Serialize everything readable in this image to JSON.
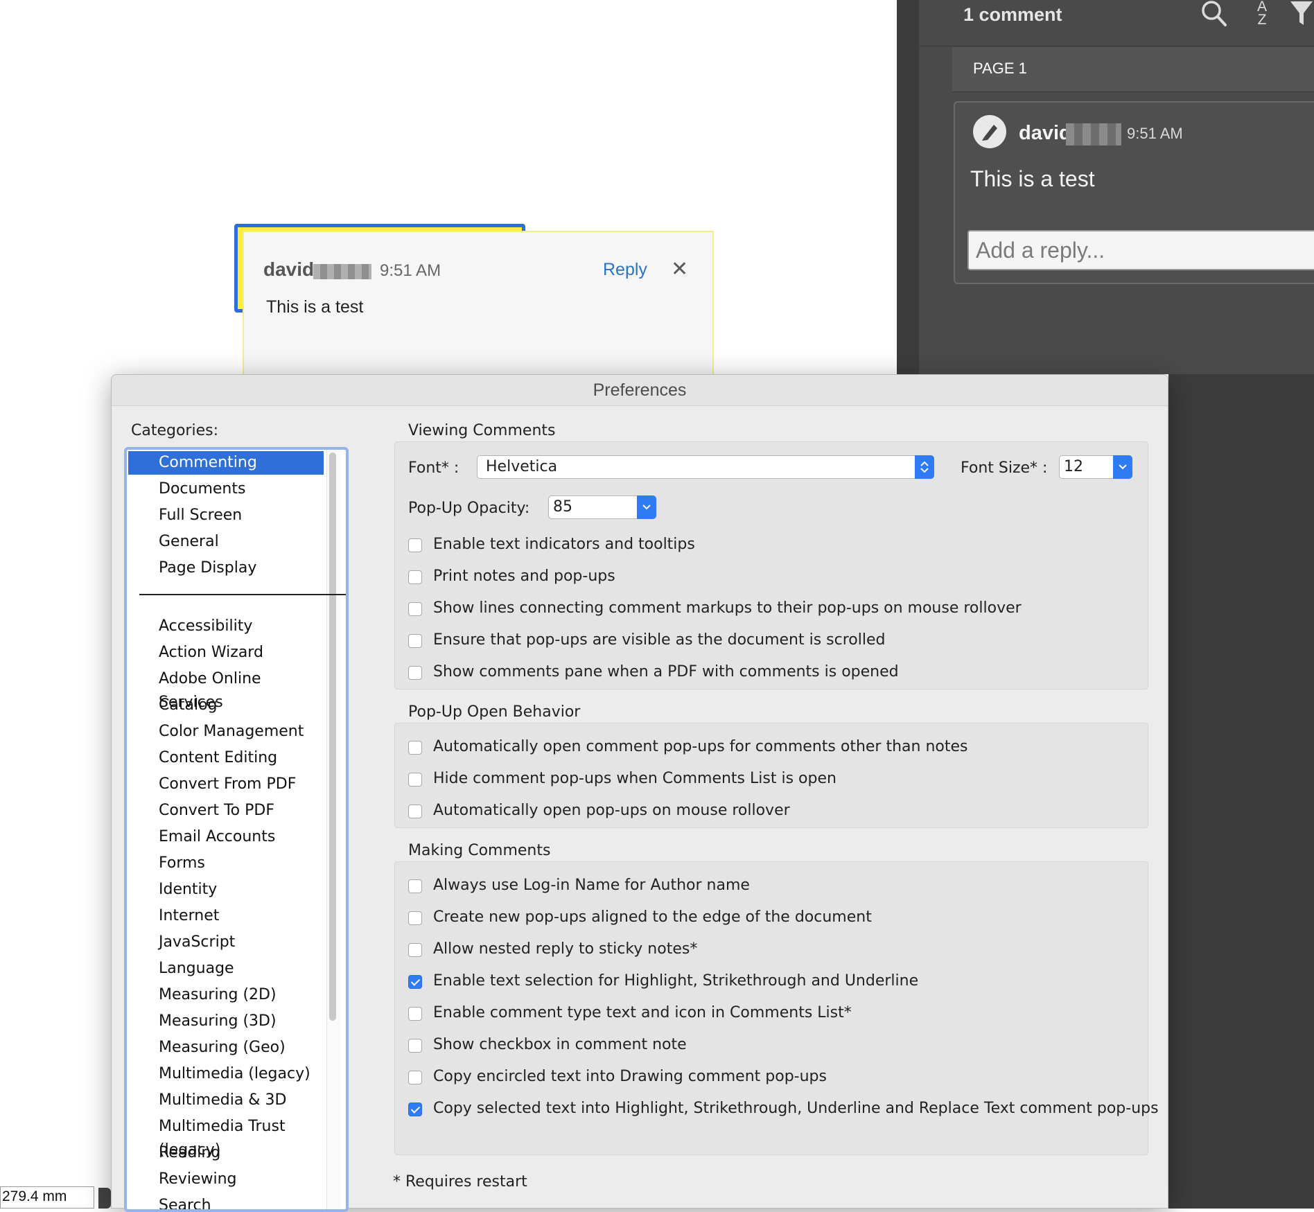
{
  "comments_pane": {
    "count_label": "1 comment",
    "sort_icon": "A\nZ",
    "page_label": "PAGE 1",
    "comment": {
      "author": "david",
      "time": "9:51 AM",
      "text": "This is a test"
    },
    "reply_placeholder": "Add a reply..."
  },
  "popup_note": {
    "author": "david",
    "time": "9:51 AM",
    "reply_label": "Reply",
    "close_glyph": "✕",
    "text": "This is a test"
  },
  "status": {
    "measurement": "279.4 mm"
  },
  "preferences": {
    "title": "Preferences",
    "categories_label": "Categories:",
    "categories_top": [
      "Commenting",
      "Documents",
      "Full Screen",
      "General",
      "Page Display"
    ],
    "categories": [
      "Accessibility",
      "Action Wizard",
      "Adobe Online Services",
      "Catalog",
      "Color Management",
      "Content Editing",
      "Convert From PDF",
      "Convert To PDF",
      "Email Accounts",
      "Forms",
      "Identity",
      "Internet",
      "JavaScript",
      "Language",
      "Measuring (2D)",
      "Measuring (3D)",
      "Measuring (Geo)",
      "Multimedia (legacy)",
      "Multimedia & 3D",
      "Multimedia Trust (legacy)",
      "Reading",
      "Reviewing",
      "Search"
    ],
    "selected_category": "Commenting",
    "viewing": {
      "title": "Viewing Comments",
      "font_label": "Font* :",
      "font_value": "Helvetica",
      "font_size_label": "Font Size* :",
      "font_size_value": "12",
      "opacity_label": "Pop-Up Opacity:",
      "opacity_value": "85",
      "options": [
        {
          "label": "Enable text indicators and tooltips",
          "checked": false
        },
        {
          "label": "Print notes and pop-ups",
          "checked": false
        },
        {
          "label": "Show lines connecting comment markups to their pop-ups on mouse rollover",
          "checked": false
        },
        {
          "label": "Ensure that pop-ups are visible as the document is scrolled",
          "checked": false
        },
        {
          "label": "Show comments pane when a PDF with comments is opened",
          "checked": false
        }
      ]
    },
    "popup_behavior": {
      "title": "Pop-Up Open Behavior",
      "options": [
        {
          "label": "Automatically open comment pop-ups for comments other than notes",
          "checked": false
        },
        {
          "label": "Hide comment pop-ups when Comments List is open",
          "checked": false
        },
        {
          "label": "Automatically open pop-ups on mouse rollover",
          "checked": false
        }
      ]
    },
    "making": {
      "title": "Making Comments",
      "options": [
        {
          "label": "Always use Log-in Name for Author name",
          "checked": false
        },
        {
          "label": "Create new pop-ups aligned to the edge of the document",
          "checked": false
        },
        {
          "label": "Allow nested reply to sticky notes*",
          "checked": false
        },
        {
          "label": "Enable text selection for Highlight, Strikethrough and Underline",
          "checked": true
        },
        {
          "label": "Enable comment type text and icon in Comments List*",
          "checked": false
        },
        {
          "label": "Show checkbox in comment note",
          "checked": false
        },
        {
          "label": "Copy encircled text into Drawing comment pop-ups",
          "checked": false
        },
        {
          "label": "Copy selected text into Highlight, Strikethrough, Underline and Replace Text comment pop-ups",
          "checked": true
        }
      ]
    },
    "restart_note": "* Requires restart"
  }
}
